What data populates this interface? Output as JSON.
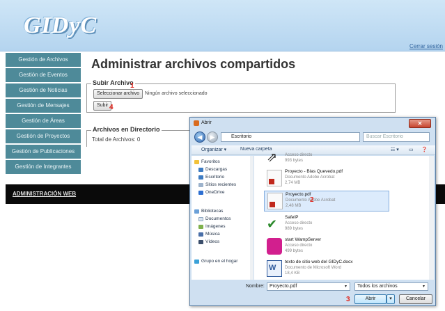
{
  "app": {
    "logo": "GIDyC",
    "logout": "Cerrar sesión"
  },
  "sidebar": {
    "items": [
      "Gestión de Archivos",
      "Gestión de Eventos",
      "Gestión de Noticias",
      "Gestión de Mensajes",
      "Gestión de Áreas",
      "Gestión de Proyectos",
      "Gestión de Publicaciones",
      "Gestión de Integrantes"
    ]
  },
  "main": {
    "title": "Administrar archivos compartidos",
    "upload": {
      "legend": "Subir Archivo",
      "select_button": "Seleccionar archivo",
      "no_file": "Ningún archivo seleccionado",
      "submit": "Subir"
    },
    "directory": {
      "legend": "Archivos en Directorio",
      "total": "Total de Archivos: 0"
    },
    "band": "ADMINISTRACIÓN WEB"
  },
  "markers": {
    "m1": "1",
    "m2": "2",
    "m3": "3",
    "m4": "4"
  },
  "dialog": {
    "title": "Abrir",
    "address": "Escritorio",
    "search_placeholder": "Buscar Escritorio",
    "toolbar": {
      "organize": "Organizar ▾",
      "new_folder": "Nueva carpeta"
    },
    "nav": {
      "favorites": "Favoritos",
      "downloads": "Descargas",
      "desktop": "Escritorio",
      "recent": "Sitios recientes",
      "onedrive": "OneDrive",
      "libraries": "Bibliotecas",
      "documents": "Documentos",
      "images": "Imágenes",
      "music": "Música",
      "videos": "Vídeos",
      "homegroup": "Grupo en el hogar"
    },
    "files": [
      {
        "name": "",
        "type": "Acceso directo",
        "size": "993 bytes"
      },
      {
        "name": "Proyecto - Blas Quevedo.pdf",
        "type": "Documento Adobe Acrobat",
        "size": "2,74 MB"
      },
      {
        "name": "Proyecto.pdf",
        "type": "Documento Adobe Acrobat",
        "size": "2,48 MB"
      },
      {
        "name": "SafeIP",
        "type": "Acceso directo",
        "size": "989 bytes"
      },
      {
        "name": "start WampServer",
        "type": "Acceso directo",
        "size": "499 bytes"
      },
      {
        "name": "texto de sitio web del GIDyC.docx",
        "type": "Documento de Microsoft Word",
        "size": "18,4 KB"
      }
    ],
    "filename_label": "Nombre:",
    "filename_value": "Proyecto.pdf",
    "filter": "Todos los archivos",
    "open": "Abrir",
    "cancel": "Cancelar"
  },
  "colors": {
    "sidebar": "#4e8a99",
    "header": "#c2dcf2",
    "marker": "#e2231a"
  }
}
